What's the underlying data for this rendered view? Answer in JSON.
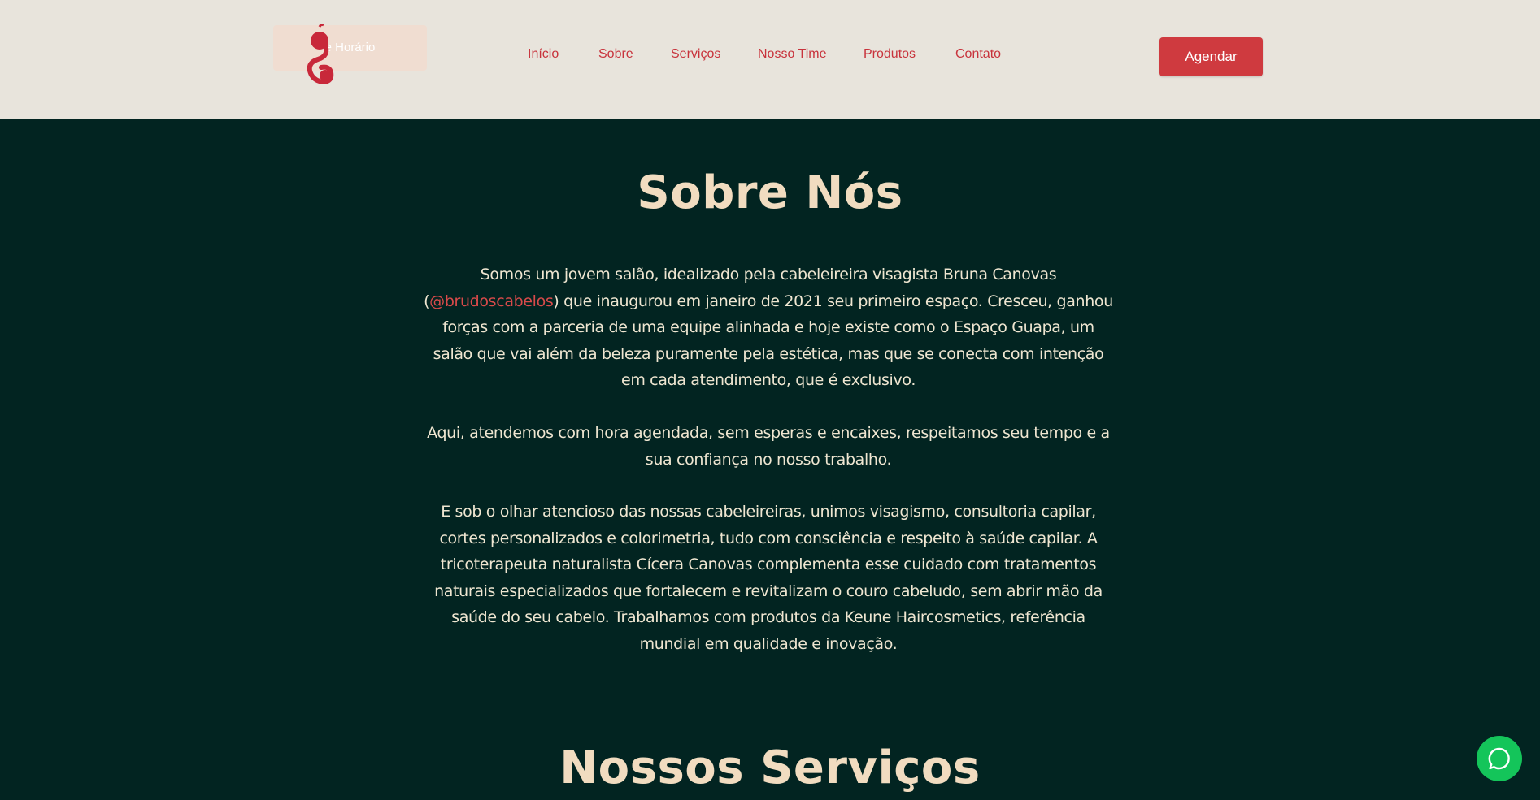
{
  "header": {
    "logo": {
      "badge_text": "e Horário",
      "glyph": "g"
    },
    "nav": [
      {
        "label": "Início"
      },
      {
        "label": "Sobre"
      },
      {
        "label": "Serviços"
      },
      {
        "label": "Nosso Time"
      },
      {
        "label": "Produtos"
      },
      {
        "label": "Contato"
      }
    ],
    "cta_label": "Agendar"
  },
  "about": {
    "title": "Sobre Nós",
    "p1_before": "Somos um jovem salão, idealizado pela cabeleireira visagista Bruna Canovas (",
    "p1_mention": "@brudoscabelos",
    "p1_after": ") que inaugurou em janeiro de 2021 seu primeiro espaço. Cresceu, ganhou forças com a parceria de uma equipe alinhada e hoje existe como o Espaço Guapa, um salão que vai além da beleza puramente pela estética, mas que se conecta com intenção em cada atendimento, que é exclusivo.",
    "p2": "Aqui, atendemos com hora agendada, sem esperas e encaixes, respeitamos seu tempo e a sua confiança no nosso trabalho.",
    "p3": "E sob o olhar atencioso das nossas cabeleireiras, unimos visagismo, consultoria capilar, cortes personalizados e colorimetria, tudo com consciência e respeito à saúde capilar. A tricoterapeuta naturalista Cícera Canovas complementa esse cuidado com tratamentos naturais especializados que fortalecem e revitalizam o couro cabeludo, sem abrir mão da saúde do seu cabelo. Trabalhamos com produtos da Keune Haircosmetics, referência mundial em qualidade e inovação."
  },
  "services": {
    "title": "Nossos Serviços"
  },
  "floating": {
    "icon": "whatsapp-icon"
  },
  "colors": {
    "header_bg": "#e8e4dc",
    "page_bg": "#022421",
    "accent": "#cf3a3f",
    "title": "#f1dcc0",
    "body_text": "#efe6d1",
    "whatsapp": "#14c55a"
  }
}
